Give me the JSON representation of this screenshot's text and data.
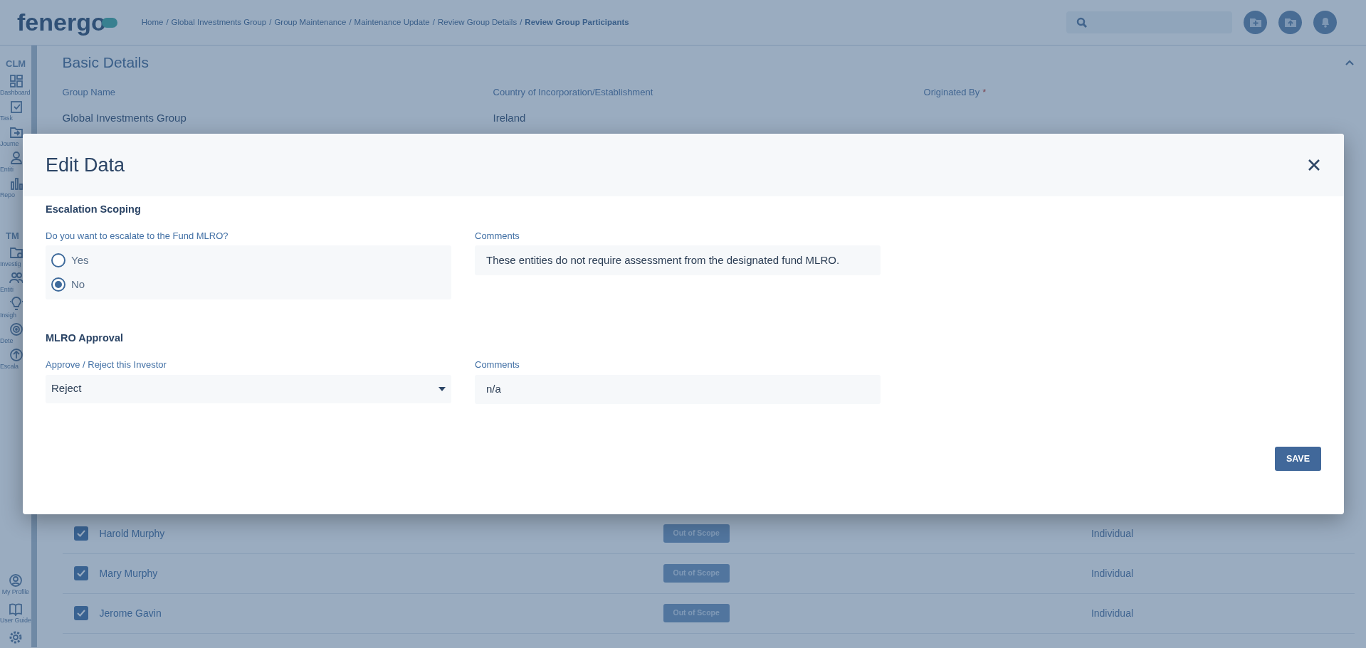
{
  "header": {
    "logo": "fenergo",
    "breadcrumb": [
      "Home",
      "Global Investments Group",
      "Group Maintenance",
      "Maintenance Update",
      "Review Group Details"
    ],
    "breadcrumb_current": "Review Group Participants",
    "separator": "/"
  },
  "sidebar": {
    "sections": [
      {
        "title": "CLM",
        "items": [
          {
            "label": "Dashboard"
          },
          {
            "label": "Task"
          },
          {
            "label": "Journe"
          },
          {
            "label": "Entiti"
          },
          {
            "label": "Repo"
          }
        ]
      },
      {
        "title": "TM",
        "items": [
          {
            "label": "Investig"
          },
          {
            "label": "Entiti"
          },
          {
            "label": "Insigh"
          },
          {
            "label": "Dete"
          },
          {
            "label": "Escala"
          }
        ]
      }
    ],
    "bottom_items": [
      {
        "label": "My Profile"
      },
      {
        "label": "User Guide"
      }
    ]
  },
  "background": {
    "section_title": "Basic Details",
    "fields": [
      {
        "label": "Group Name",
        "value": "Global Investments Group"
      },
      {
        "label": "Country of Incorporation/Establishment",
        "value": "Ireland"
      },
      {
        "label": "Originated By",
        "required_mark": "*"
      }
    ],
    "rows": [
      {
        "name": "Harold Murphy",
        "checked": true,
        "status": "Out of Scope",
        "type": "Individual"
      },
      {
        "name": "Mary Murphy",
        "checked": true,
        "status": "Out of Scope",
        "type": "Individual"
      },
      {
        "name": "Jerome Gavin",
        "checked": true,
        "status": "Out of Scope",
        "type": "Individual"
      }
    ]
  },
  "modal": {
    "title": "Edit Data",
    "sections": [
      {
        "title": "Escalation Scoping",
        "fields": [
          {
            "kind": "radio",
            "label": "Do you want to escalate to the Fund MLRO?",
            "options": [
              {
                "label": "Yes",
                "selected": false
              },
              {
                "label": "No",
                "selected": true
              }
            ]
          },
          {
            "kind": "text",
            "label": "Comments",
            "value": "These entities do not require assessment from the designated fund MLRO."
          }
        ]
      },
      {
        "title": "MLRO Approval",
        "fields": [
          {
            "kind": "select",
            "label": "Approve / Reject this Investor",
            "value": "Reject"
          },
          {
            "kind": "text",
            "label": "Comments",
            "value": "n/a"
          }
        ]
      }
    ],
    "save_button": "SAVE"
  }
}
